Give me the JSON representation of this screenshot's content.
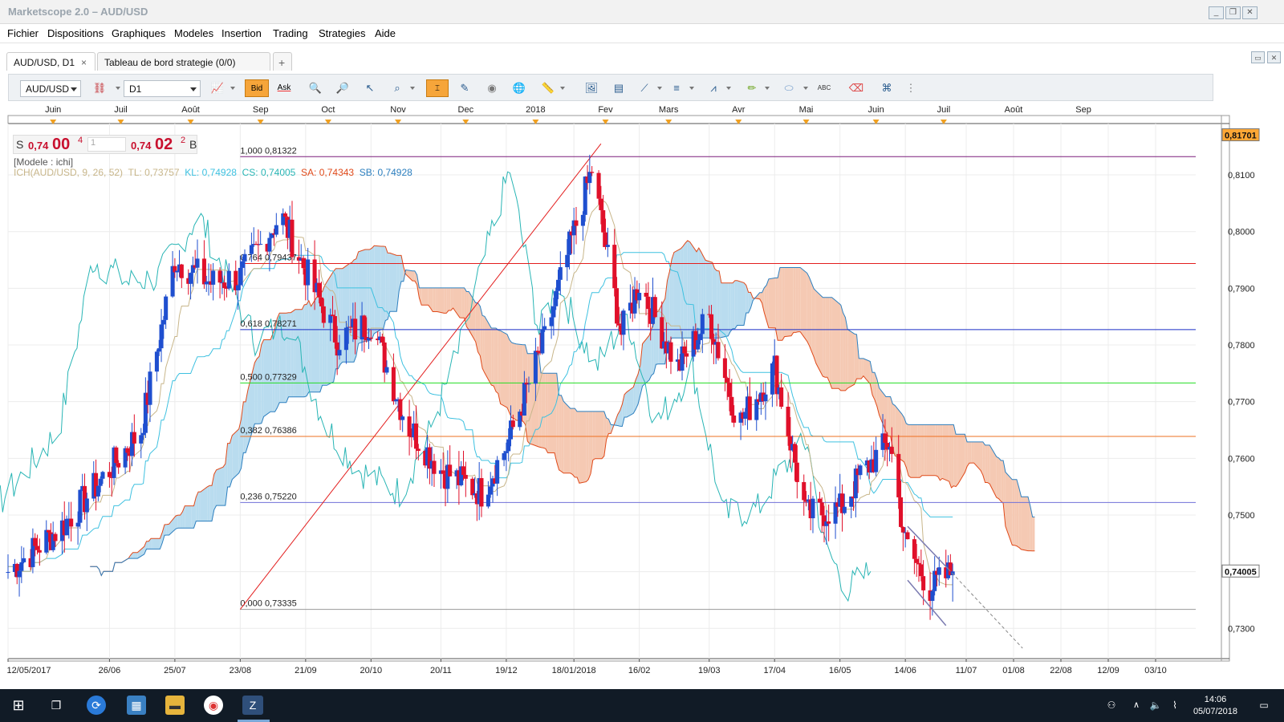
{
  "window": {
    "title": "Marketscope 2.0 – AUD/USD"
  },
  "menu": [
    "Fichier",
    "Dispositions",
    "Graphiques",
    "Modeles",
    "Insertion",
    "Trading",
    "Strategies",
    "Aide"
  ],
  "tabs": [
    {
      "label": "AUD/USD, D1",
      "close": "×"
    },
    {
      "label": "Tableau de bord strategie (0/0)"
    }
  ],
  "tab_add": "+",
  "toolbar": {
    "symbol": "AUD/USD",
    "timeframe": "D1",
    "bid_label": "Bid",
    "ask_label": "Ask"
  },
  "quote": {
    "sell_prefix": "S",
    "sell_main": "0,74",
    "sell_big": "00",
    "sell_sup": "4",
    "amount": "1",
    "buy_main": "0,74",
    "buy_big": "02",
    "buy_sup": "2",
    "buy_suffix": "B"
  },
  "indicator_lines": {
    "model": "[Modele : ichi]",
    "name": "ICH(AUD/USD, 9, 26, 52)",
    "tl": "TL: 0,73757",
    "kl": "KL: 0,74928",
    "cs": "CS: 0,74005",
    "sa": "SA: 0,74343",
    "sb": "SB: 0,74928"
  },
  "colors": {
    "bull": "#1f4fcf",
    "bear": "#e0102a",
    "tenkan": "#c8b68a",
    "kijun": "#3ec1e0",
    "chikou": "#29b5b5",
    "span_a": "#e04a1a",
    "span_b": "#2c7fbf",
    "cloud_bull": "#b9dcef",
    "cloud_bear": "#f5c9b3",
    "price_tag": "#ffa735"
  },
  "chart_data": {
    "type": "candlestick",
    "instrument": "AUD/USD",
    "timeframe": "D1",
    "ylim": [
      0.7265,
      0.8185
    ],
    "y_ticks": [
      "0,8100",
      "0,8000",
      "0,7900",
      "0,7800",
      "0,7700",
      "0,7600",
      "0,7500",
      "0,7400",
      "0,7300"
    ],
    "y_tick_values": [
      0.81,
      0.8,
      0.79,
      0.78,
      0.77,
      0.76,
      0.75,
      0.74,
      0.73
    ],
    "current_price": {
      "label": "0,74005",
      "value": 0.74005
    },
    "top_price": {
      "label": "0,81701",
      "value": 0.81701
    },
    "month_labels": [
      "Juin",
      "Juil",
      "Août",
      "Sep",
      "Oct",
      "Nov",
      "Dec",
      "2018",
      "Fev",
      "Mars",
      "Avr",
      "Mai",
      "Juin",
      "Juil",
      "Août",
      "Sep"
    ],
    "date_labels": [
      "12/05/2017",
      "26/06",
      "25/07",
      "23/08",
      "21/09",
      "20/10",
      "20/11",
      "19/12",
      "18/01/2018",
      "16/02",
      "19/03",
      "17/04",
      "16/05",
      "14/06",
      "11/07",
      "01/08",
      "22/08",
      "12/09",
      "03/10"
    ],
    "fibonacci": [
      {
        "label": "1,000 0,81322",
        "value": 0.81322,
        "color": "#7b1e7b"
      },
      {
        "label": "0,764 0,79437",
        "value": 0.79437,
        "color": "#e31e1e"
      },
      {
        "label": "0,618 0,78271",
        "value": 0.78271,
        "color": "#1a2fc8"
      },
      {
        "label": "0,500 0,77329",
        "value": 0.77329,
        "color": "#22dd22"
      },
      {
        "label": "0,382 0,76386",
        "value": 0.76386,
        "color": "#ee7020"
      },
      {
        "label": "0,236 0,75220",
        "value": 0.7522,
        "color": "#7070d8"
      },
      {
        "label": "0,000 0,73335",
        "value": 0.73335,
        "color": "#999999"
      }
    ],
    "close_anchors": [
      {
        "date": "2017-05-12",
        "close": 0.74
      },
      {
        "date": "2017-06-05",
        "close": 0.748
      },
      {
        "date": "2017-06-26",
        "close": 0.758
      },
      {
        "date": "2017-07-10",
        "close": 0.765
      },
      {
        "date": "2017-07-25",
        "close": 0.795
      },
      {
        "date": "2017-08-10",
        "close": 0.791
      },
      {
        "date": "2017-08-23",
        "close": 0.792
      },
      {
        "date": "2017-09-10",
        "close": 0.803
      },
      {
        "date": "2017-09-21",
        "close": 0.793
      },
      {
        "date": "2017-10-05",
        "close": 0.781
      },
      {
        "date": "2017-10-20",
        "close": 0.784
      },
      {
        "date": "2017-11-05",
        "close": 0.766
      },
      {
        "date": "2017-11-20",
        "close": 0.758
      },
      {
        "date": "2017-12-08",
        "close": 0.754
      },
      {
        "date": "2017-12-19",
        "close": 0.762
      },
      {
        "date": "2018-01-05",
        "close": 0.781
      },
      {
        "date": "2018-01-18",
        "close": 0.8
      },
      {
        "date": "2018-01-26",
        "close": 0.811
      },
      {
        "date": "2018-02-08",
        "close": 0.782
      },
      {
        "date": "2018-02-16",
        "close": 0.791
      },
      {
        "date": "2018-03-05",
        "close": 0.776
      },
      {
        "date": "2018-03-19",
        "close": 0.785
      },
      {
        "date": "2018-04-01",
        "close": 0.766
      },
      {
        "date": "2018-04-17",
        "close": 0.776
      },
      {
        "date": "2018-05-01",
        "close": 0.75
      },
      {
        "date": "2018-05-16",
        "close": 0.751
      },
      {
        "date": "2018-05-25",
        "close": 0.757
      },
      {
        "date": "2018-06-07",
        "close": 0.763
      },
      {
        "date": "2018-06-14",
        "close": 0.745
      },
      {
        "date": "2018-06-25",
        "close": 0.737
      },
      {
        "date": "2018-07-05",
        "close": 0.74005
      }
    ]
  },
  "taskbar": {
    "time": "14:06",
    "date": "05/07/2018"
  }
}
